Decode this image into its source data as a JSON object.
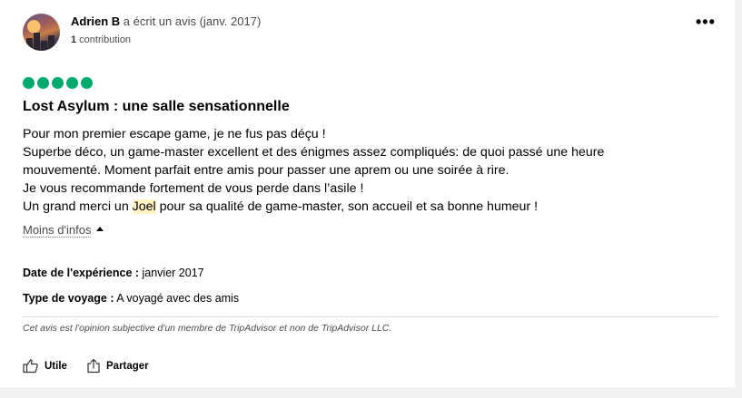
{
  "review": {
    "author_name": "Adrien B",
    "author_suffix": " a écrit un avis (janv. 2017)",
    "contrib_count": "1",
    "contrib_label": " contribution",
    "more_label": "•••",
    "rating": 5,
    "rating_color": "#00aa6c",
    "title": "Lost Asylum : une salle sensationnelle",
    "body_lines": [
      "Pour mon premier escape game, je ne fus pas déçu !",
      "Superbe déco, un game-master excellent et des énigmes assez compliqués: de quoi passé une heure",
      "mouvementé. Moment parfait entre amis pour passer une aprem ou une soirée à rire.",
      "Je vous recommande fortement de vous perde dans l’asile !"
    ],
    "body_last_pre": "Un grand merci un ",
    "body_last_highlight": "Joel",
    "body_last_post": " pour sa qualité de game-master, son accueil et sa bonne humeur !",
    "less_label": "Moins d'infos",
    "experience_label": "Date de l'expérience :",
    "experience_value": " janvier 2017",
    "trip_label": "Type de voyage :",
    "trip_value": " A voyagé avec des amis",
    "disclaimer": "Cet avis est l'opinion subjective d'un membre de TripAdvisor et non de TripAdvisor LLC.",
    "helpful_label": "Utile",
    "share_label": "Partager"
  }
}
